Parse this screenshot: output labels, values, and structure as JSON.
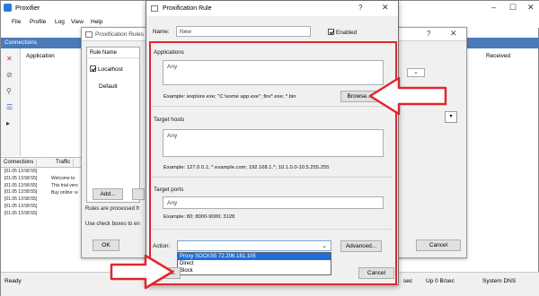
{
  "main_window": {
    "title": "Proxifier",
    "menu": [
      "File",
      "Profile",
      "Log",
      "View",
      "Help"
    ],
    "connections_header": "Connections",
    "columns": {
      "application": "Application",
      "received": "Received"
    },
    "tabs": [
      "Connections",
      "Traffic"
    ],
    "log": {
      "timestamps": [
        "[01.05 13:58:55]",
        "[01.05 13:58:55]",
        "[01.05 13:58:55]",
        "[01.05 13:58:55]",
        "[01.05 13:58:55]",
        "[01.05 13:58:55]",
        "[01.05 13:58:55]"
      ],
      "messages": [
        "Welcome to",
        "This trial vers",
        "Buy online: w"
      ]
    },
    "status": {
      "ready": "Ready",
      "sec": "sec",
      "up": "Up 0 B/sec",
      "dns": "System DNS"
    }
  },
  "rules_window": {
    "title": "Proxification Rules",
    "table_header": "Rule Name",
    "rows": [
      {
        "name": "Localhost",
        "checked": true
      },
      {
        "name": "Default",
        "checked": false
      }
    ],
    "add_button": "Add...",
    "note1": "Rules are processed fr",
    "note2": "Use check boxes to en",
    "ok_button": "OK",
    "cancel_button": "Cancel"
  },
  "rule_dialog": {
    "title": "Proxification Rule",
    "help_glyph": "?",
    "close_glyph": "✕",
    "name_label": "Name:",
    "name_value": "New",
    "enabled_label": "Enabled",
    "enabled_checked": true,
    "applications": {
      "label": "Applications",
      "value": "Any",
      "example": "Example: iexplore.exe; \"C:\\some app.exe\"; fire*.exe; *.bin",
      "browse_button": "Browse..."
    },
    "target_hosts": {
      "label": "Target hosts",
      "value": "Any",
      "example": "Example: 127.0.0.1; *.example.com; 192.168.1.*; 10.1.0.0-10.5.255.255"
    },
    "target_ports": {
      "label": "Target ports",
      "value": "Any",
      "example": "Example: 80; 8000-9000; 3128"
    },
    "action": {
      "label": "Action:",
      "options": [
        "Proxy SOCKS5 72.206.181.105",
        "Direct",
        "Block"
      ],
      "highlighted": "Proxy SOCKS5 72.206.181.105",
      "advanced_button": "Advanced..."
    },
    "ok_button": "OK",
    "cancel_button": "Cancel"
  },
  "icons": {
    "app": "proxifier-icon",
    "close": "close-icon",
    "dropdown": "chevron-down-icon"
  },
  "colors": {
    "highlight_red": "#e0262d",
    "selection_blue": "#1e6fd9",
    "connections_header": "#4a7ab8"
  }
}
